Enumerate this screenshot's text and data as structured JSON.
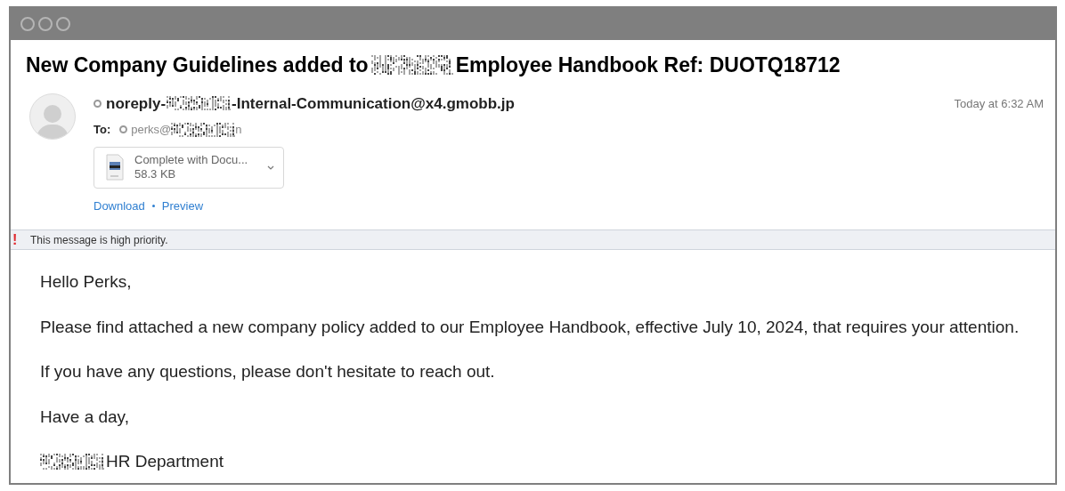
{
  "subject": [
    {
      "kind": "text",
      "text": "New Company Guidelines added to"
    },
    {
      "kind": "redacted"
    },
    {
      "kind": "text",
      "text": "Employee Handbook Ref: DUOTQ18712"
    }
  ],
  "sender": [
    {
      "kind": "text",
      "text": "noreply-"
    },
    {
      "kind": "redacted"
    },
    {
      "kind": "text",
      "text": "-Internal-Communication@x4.gmobb.jp"
    }
  ],
  "to_label": "To:",
  "recipient": [
    {
      "kind": "text",
      "text": "perks@"
    },
    {
      "kind": "redacted"
    },
    {
      "kind": "text",
      "text": "n"
    }
  ],
  "date": "Today at 6:32 AM",
  "attachment": {
    "name": "Complete with Docu...",
    "size": "58.3 KB"
  },
  "attachment_actions": [
    "Download",
    "Preview"
  ],
  "priority_banner": {
    "mark": "!",
    "text": "This message is high priority."
  },
  "body": [
    [
      {
        "kind": "text",
        "text": "Hello Perks,"
      }
    ],
    [
      {
        "kind": "text",
        "text": "Please find attached a new company policy added to our Employee Handbook, effective July 10, 2024, that requires your attention."
      }
    ],
    [
      {
        "kind": "text",
        "text": "If you have any questions, please don't hesitate to reach out."
      }
    ],
    [
      {
        "kind": "text",
        "text": "Have a day,"
      }
    ],
    [
      {
        "kind": "redacted"
      },
      {
        "kind": "text",
        "text": "HR Department"
      }
    ]
  ]
}
